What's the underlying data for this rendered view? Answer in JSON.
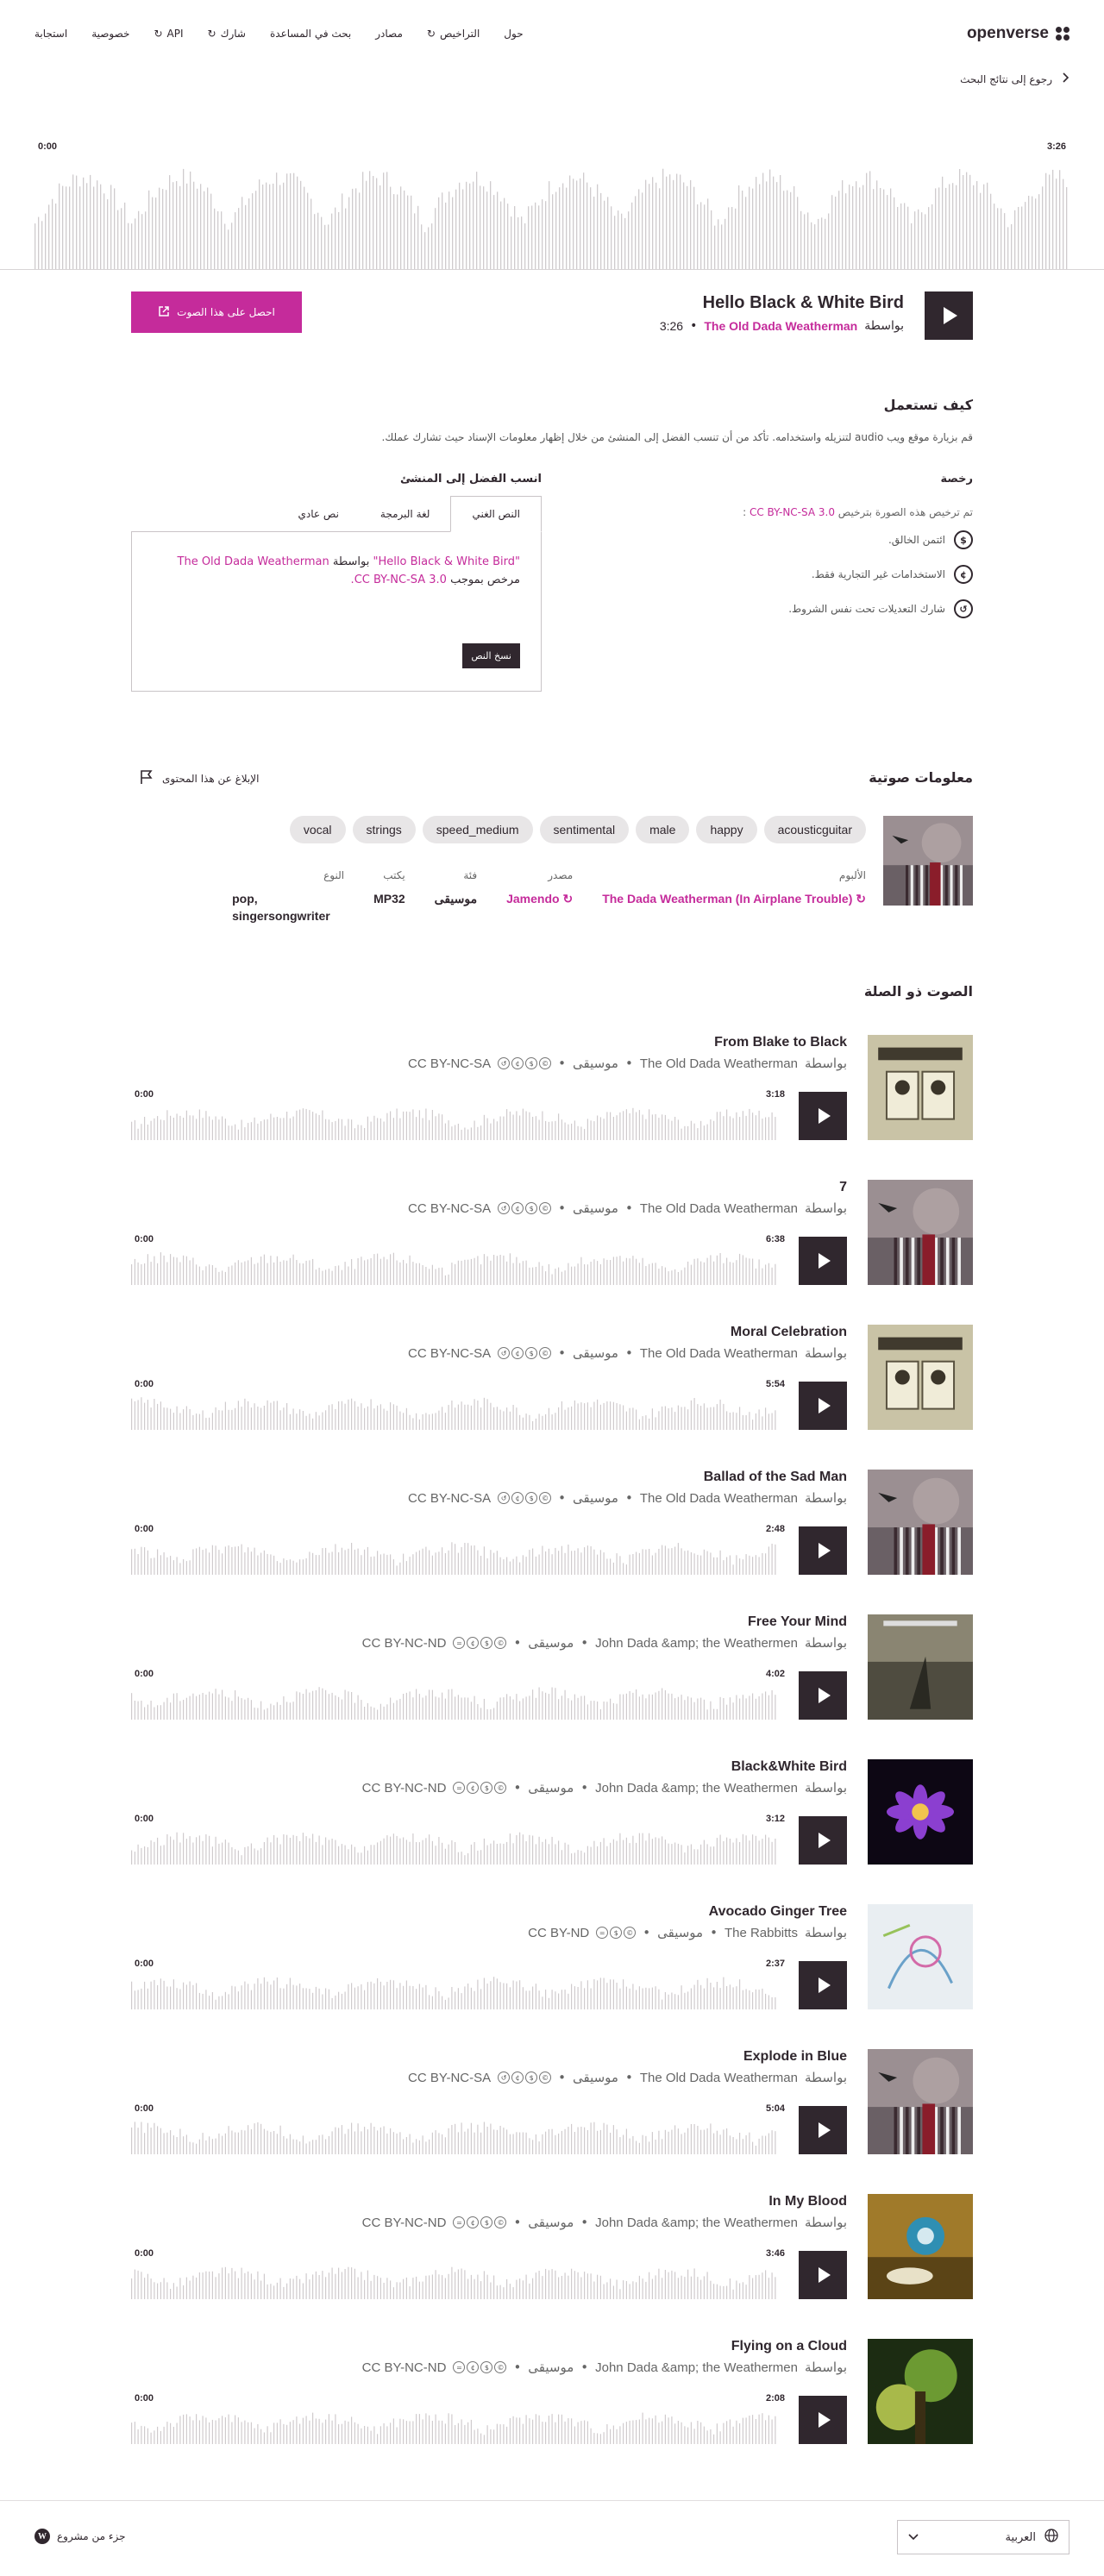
{
  "header": {
    "logo": "openverse",
    "nav": [
      {
        "label": "حول"
      },
      {
        "label": "التراخيص",
        "external": true
      },
      {
        "label": "مصادر"
      },
      {
        "label": "بحث في المساعدة"
      },
      {
        "label": "شارك",
        "external": true
      },
      {
        "label": "API",
        "external": true
      },
      {
        "label": "خصوصية"
      },
      {
        "label": "استجابة"
      }
    ]
  },
  "back_link": "رجوع إلى نتائج البحث",
  "player": {
    "time_start": "0:00",
    "time_end": "3:26",
    "title": "Hello Black & White Bird",
    "by": "بواسطة",
    "creator": "The Old Dada Weatherman",
    "duration": "3:26",
    "download": "احصل على هذا الصوت"
  },
  "how_to_use": {
    "title": "كيف تستعمل",
    "text": "قم بزيارة موقع ويب audio لتنزيله واستخدامه. تأكد من أن تنسب الفضل إلى المنشئ من خلال إظهار معلومات الإسناد حيث تشارك عملك.",
    "license_header": "رخصة",
    "license_line": "تم ترخيص هذه الصورة بترخيص",
    "license_name": "CC BY-NC-SA 3.0",
    "license_items": [
      {
        "icon": "$",
        "text": "ائتمن الخالق."
      },
      {
        "icon": "¢",
        "text": "الاستخدامات غير التجارية فقط."
      },
      {
        "icon": "↺",
        "text": "شارك التعديلات تحت نفس الشروط."
      }
    ],
    "attribution_header": "انسب الفضل إلى المنشئ",
    "tabs": [
      "النص الغني",
      "لغة البرمجة",
      "نص عادي"
    ],
    "attr_quote": "\"Hello Black & White Bird\"",
    "attr_by": "بواسطة",
    "attr_creator": "The Old Dada Weatherman",
    "attr_licensed": "مرخص بموجب",
    "attr_license": "CC BY-NC-SA 3.0.",
    "copy_button": "نسخ النص"
  },
  "audio_info": {
    "title": "معلومات صوتية",
    "report": "الإبلاغ عن هذا المحتوى",
    "tags": [
      "acousticguitar",
      "happy",
      "male",
      "sentimental",
      "speed_medium",
      "strings",
      "vocal"
    ],
    "meta": [
      {
        "label": "الألبوم",
        "value": "The Dada Weatherman (In Airplane Trouble)",
        "link": true
      },
      {
        "label": "مصدر",
        "value": "Jamendo",
        "link": true
      },
      {
        "label": "فئة",
        "value": "موسيقى",
        "link": false
      },
      {
        "label": "يكتب",
        "value": "MP32",
        "link": false
      },
      {
        "label": "النوع",
        "value": "pop, singersongwriter",
        "link": false
      }
    ]
  },
  "related": {
    "title": "الصوت ذو الصلة",
    "by": "بواسطة",
    "category": "موسيقى",
    "items": [
      {
        "title": "From Blake to Black",
        "creator": "The Old Dada Weatherman",
        "license": "CC BY-NC-SA",
        "duration": "3:18",
        "start": "0:00",
        "cover": "portraits"
      },
      {
        "title": "7",
        "creator": "The Old Dada Weatherman",
        "license": "CC BY-NC-SA",
        "duration": "6:38",
        "start": "0:00",
        "cover": "plane"
      },
      {
        "title": "Moral Celebration",
        "creator": "The Old Dada Weatherman",
        "license": "CC BY-NC-SA",
        "duration": "5:54",
        "start": "0:00",
        "cover": "portraits"
      },
      {
        "title": "Ballad of the Sad Man",
        "creator": "The Old Dada Weatherman",
        "license": "CC BY-NC-SA",
        "duration": "2:48",
        "start": "0:00",
        "cover": "plane"
      },
      {
        "title": "Free Your Mind",
        "creator": "John Dada &amp; the Weathermen",
        "license": "CC BY-NC-ND",
        "duration": "4:02",
        "start": "0:00",
        "cover": "dada"
      },
      {
        "title": "Black&White Bird",
        "creator": "John Dada &amp; the Weathermen",
        "license": "CC BY-NC-ND",
        "duration": "3:12",
        "start": "0:00",
        "cover": "lotus"
      },
      {
        "title": "Avocado Ginger Tree",
        "creator": "The Rabbitts",
        "license": "CC BY-ND",
        "duration": "2:37",
        "start": "0:00",
        "cover": "sketch"
      },
      {
        "title": "Explode in Blue",
        "creator": "The Old Dada Weatherman",
        "license": "CC BY-NC-SA",
        "duration": "5:04",
        "start": "0:00",
        "cover": "plane"
      },
      {
        "title": "In My Blood",
        "creator": "John Dada &amp; the Weathermen",
        "license": "CC BY-NC-ND",
        "duration": "3:46",
        "start": "0:00",
        "cover": "bird"
      },
      {
        "title": "Flying on a Cloud",
        "creator": "John Dada &amp; the Weathermen",
        "license": "CC BY-NC-ND",
        "duration": "2:08",
        "start": "0:00",
        "cover": "garden"
      }
    ]
  },
  "footer": {
    "wordpress": "جزء من مشروع",
    "language": "العربية"
  }
}
